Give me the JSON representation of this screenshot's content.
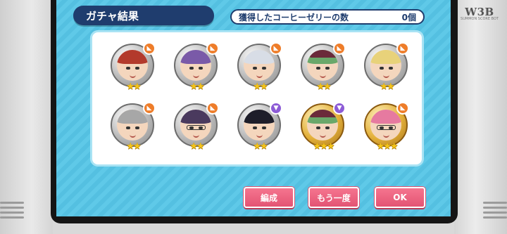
{
  "brand": {
    "logo": "W3B",
    "tagline": "SUMMON SCORE BOT"
  },
  "header": {
    "title": "ガチャ結果"
  },
  "counter": {
    "label": "獲得したコーヒーゼリーの数",
    "value": "0個"
  },
  "results": [
    {
      "id": 1,
      "rarity": 2,
      "medal": "silver",
      "badge": "orange",
      "hair": "#b33a2c"
    },
    {
      "id": 2,
      "rarity": 2,
      "medal": "silver",
      "badge": "orange",
      "hair": "#7a5aa8"
    },
    {
      "id": 3,
      "rarity": 2,
      "medal": "silver",
      "badge": "orange",
      "hair": "#d8dde6"
    },
    {
      "id": 4,
      "rarity": 2,
      "medal": "silver",
      "badge": "orange",
      "hair": "#6aa86a",
      "hat": true
    },
    {
      "id": 5,
      "rarity": 2,
      "medal": "silver",
      "badge": "orange",
      "hair": "#e8d27a"
    },
    {
      "id": 6,
      "rarity": 2,
      "medal": "silver",
      "badge": "orange",
      "hair": "#a7a7a7"
    },
    {
      "id": 7,
      "rarity": 2,
      "medal": "silver",
      "badge": "orange",
      "hair": "#4a3a5e",
      "glasses": true
    },
    {
      "id": 8,
      "rarity": 2,
      "medal": "silver",
      "badge": "purple",
      "hair": "#1e1e2a"
    },
    {
      "id": 9,
      "rarity": 3,
      "medal": "gold",
      "badge": "purple",
      "hair": "#6aa86a",
      "hat": true
    },
    {
      "id": 10,
      "rarity": 3,
      "medal": "gold",
      "badge": "orange",
      "hair": "#e67aa0",
      "glasses": true
    }
  ],
  "buttons": {
    "edit": "編成",
    "again": "もう一度",
    "ok": "OK"
  },
  "colors": {
    "accent": "#1f3d6e",
    "button": "#e35473",
    "panel": "#5fc9e8"
  }
}
